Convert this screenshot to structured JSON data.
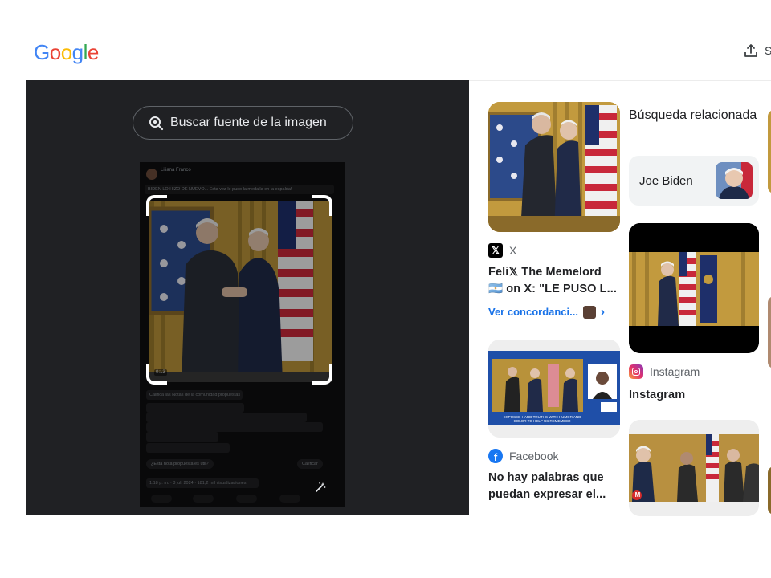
{
  "header": {
    "logo_text": "Google",
    "logo_colors": [
      "#4285F4",
      "#EA4335",
      "#FBBC05",
      "#4285F4",
      "#34A853",
      "#EA4335"
    ],
    "share_label": "S"
  },
  "lens": {
    "search_source_label": "Buscar fuente de la imagen",
    "phone": {
      "user_name": "Liliana Franco",
      "tweet_text": "BIDEN LO HIZO DE NUEVO... Esta vez le puso la medalla en la espalda!",
      "video_time": "0:13",
      "community_heading": "Califica las Notas de la comunidad propuestas",
      "rate_prompt": "¿Esta nota propuesta es útil?",
      "rate_button": "Calificar",
      "footer_meta": "1:18 p. m. · 3 jul. 2024 · 181,2 mil visualizaciones"
    }
  },
  "results": {
    "related_heading": "Búsqueda relacionada",
    "chips": [
      {
        "label": "Joe Biden"
      }
    ],
    "cards": [
      {
        "source": "X",
        "title": "Feli𝕏 The Memelord 🇦🇷 on X: \"LE PUSO L...",
        "match_link": "Ver concordanci..."
      },
      {
        "source": "Instagram",
        "title": "Instagram"
      },
      {
        "source": "Facebook",
        "title": "No hay palabras que puedan expresar el..."
      },
      {
        "source": "M",
        "title": ""
      }
    ],
    "ticker_text": "EXPOSED HARD TRUTHS WITH HUMOR AND COLOR TO HELP US REMEMBER"
  },
  "colors": {
    "lens_bg": "#202124",
    "link_blue": "#1a73e8",
    "chip_bg": "#f1f3f4"
  }
}
